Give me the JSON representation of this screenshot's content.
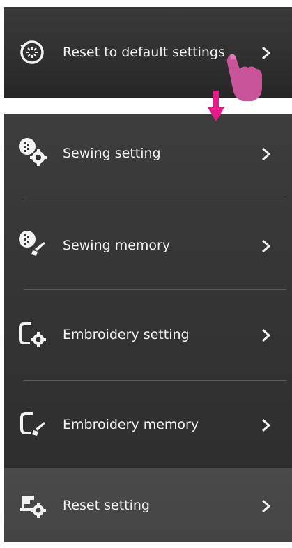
{
  "top": {
    "item": {
      "label": "Reset to default settings",
      "icon": "reset-cycle-icon"
    }
  },
  "menu": {
    "items": [
      {
        "label": "Sewing setting",
        "icon": "sewing-setting-icon"
      },
      {
        "label": "Sewing memory",
        "icon": "sewing-memory-icon"
      },
      {
        "label": "Embroidery setting",
        "icon": "embroidery-setting-icon"
      },
      {
        "label": "Embroidery memory",
        "icon": "embroidery-memory-icon"
      },
      {
        "label": "Reset setting",
        "icon": "reset-setting-icon"
      }
    ]
  },
  "colors": {
    "panel_bg": "#333333",
    "text": "#f2f2f2",
    "accent_arrow": "#e8198b",
    "hand": "#c8559a"
  }
}
